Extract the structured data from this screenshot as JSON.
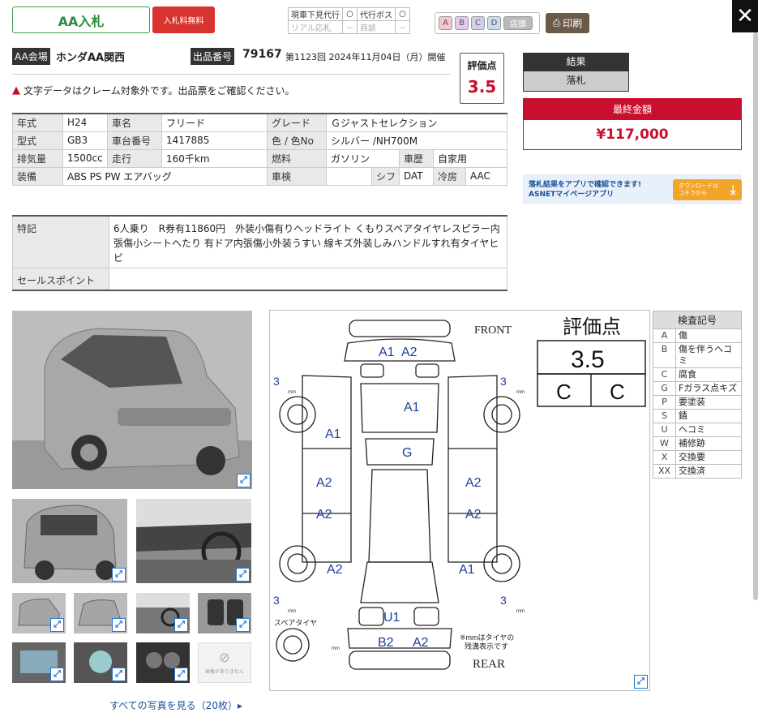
{
  "header": {
    "aa_button": "AA入札",
    "fee_button": "入札料無料",
    "services": [
      {
        "label": "現車下見代行",
        "mark": "○"
      },
      {
        "label": "代行ボス",
        "mark": "○"
      },
      {
        "label": "リアル応札",
        "mark": "－"
      },
      {
        "label": "商談",
        "mark": "－"
      }
    ],
    "legend_badges": [
      "A",
      "B",
      "C",
      "D",
      "店頭"
    ],
    "print_button": "印刷",
    "close_icon": "✕"
  },
  "info": {
    "venue_tag": "AA会場",
    "venue_name": "ホンダAA関西",
    "lot_tag": "出品番号",
    "lot_no": "79167",
    "session": "第1123回 2024年11月04日（月）開催",
    "grade_label": "評価点",
    "grade_value": "3.5",
    "warning": "文字データはクレーム対象外です。出品票をご確認ください。"
  },
  "spec": {
    "year_h": "年式",
    "year": "H24",
    "name_h": "車名",
    "name": "フリード",
    "grade_h": "グレード",
    "grade": "Ｇジャストセレクション",
    "model_h": "型式",
    "model": "GB3",
    "chassis_h": "車台番号",
    "chassis": "1417885",
    "color_h": "色 / 色No",
    "color": "シルバー /NH700M",
    "disp_h": "排気量",
    "disp": "1500cc",
    "mileage_h": "走行",
    "mileage": "160千km",
    "fuel_h": "燃料",
    "fuel": "ガソリン",
    "history_h": "車歴",
    "history": "自家用",
    "equip_h": "装備",
    "equip": "ABS PS PW エアバッグ",
    "inspect_h": "車検",
    "inspect": "",
    "shift_h": "シフト",
    "shift": "DAT",
    "ac_h": "冷房",
    "ac": "AAC",
    "notes_h": "特記",
    "notes": "6人乗り　R券有11860円　外装小傷有りヘッドライト くもりスペアタイヤレスピラー内張傷小シートへたり 有ドア内張傷小外装うすい 線キズ外装しみハンドルすれ有タイヤヒビ",
    "sales_h": "セールスポイント",
    "sales": ""
  },
  "result": {
    "head": "結果",
    "value": "落札",
    "final_head": "最終金額",
    "final_value": "¥117,000"
  },
  "banner": {
    "line1": "落札結果をアプリで確認できます!",
    "line2": "ASNETマイページアプリ",
    "dl1": "ダウンロードは",
    "dl2": "コチラから"
  },
  "photos": {
    "all_link": "すべての写真を見る（20枚）▸",
    "no_photo": "画像がありません"
  },
  "diagram": {
    "front": "FRONT",
    "rear": "REAR",
    "spare": "スペアタイヤ",
    "note1": "※mmはタイヤの",
    "note2": "残溝表示です",
    "card_title": "評価点",
    "card_score": "3.5",
    "card_int": "C",
    "card_ext": "C",
    "marks": {
      "m1": "A1",
      "m2": "A2",
      "m3": "A1",
      "m4": "G",
      "m5": "A1",
      "m6": "A2",
      "m7": "A2",
      "m8": "A2",
      "m9": "A2",
      "m10": "A2",
      "m11": "A1",
      "m12": "U1",
      "m13": "B2",
      "m14": "A2"
    },
    "tread": "3",
    "mm": "mm"
  },
  "codes": {
    "title": "検査記号",
    "rows": [
      {
        "k": "A",
        "v": "傷"
      },
      {
        "k": "B",
        "v": "傷を伴うヘコミ"
      },
      {
        "k": "C",
        "v": "腐食"
      },
      {
        "k": "G",
        "v": "Fガラス点キズ"
      },
      {
        "k": "P",
        "v": "要塗装"
      },
      {
        "k": "S",
        "v": "錆"
      },
      {
        "k": "U",
        "v": "ヘコミ"
      },
      {
        "k": "W",
        "v": "補修跡"
      },
      {
        "k": "X",
        "v": "交換要"
      },
      {
        "k": "XX",
        "v": "交換済"
      }
    ]
  },
  "colors": {
    "accent_red": "#c8102e",
    "green": "#2e8b3e",
    "blue": "#1c4e9c"
  }
}
